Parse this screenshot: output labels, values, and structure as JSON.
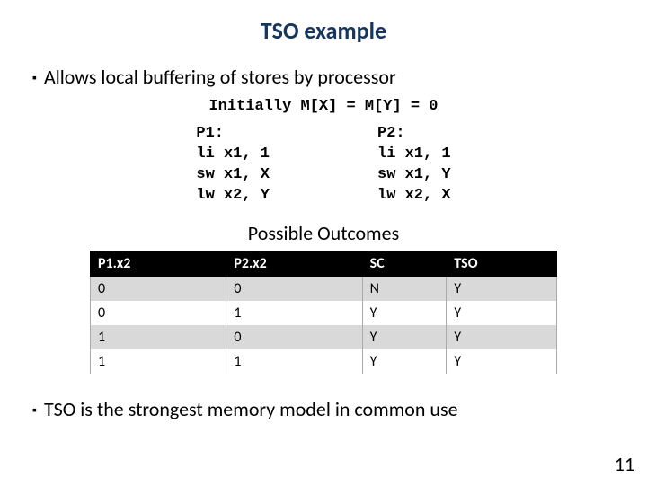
{
  "title": "TSO example",
  "bullet1": "Allows local buffering of stores by processor",
  "initial": "Initially M[X] = M[Y] = 0",
  "p1": {
    "label": "P1:",
    "l1": "li x1, 1",
    "l2": "sw x1, X",
    "l3": "lw x2, Y"
  },
  "p2": {
    "label": "P2:",
    "l1": "li x1, 1",
    "l2": "sw x1, Y",
    "l3": "lw x2, X"
  },
  "outcomes_title": "Possible Outcomes",
  "headers": {
    "c1": "P1.x2",
    "c2": "P2.x2",
    "c3": "SC",
    "c4": "TSO"
  },
  "rows": [
    {
      "c1": "0",
      "c2": "0",
      "c3": "N",
      "c4": "Y"
    },
    {
      "c1": "0",
      "c2": "1",
      "c3": "Y",
      "c4": "Y"
    },
    {
      "c1": "1",
      "c2": "0",
      "c3": "Y",
      "c4": "Y"
    },
    {
      "c1": "1",
      "c2": "1",
      "c3": "Y",
      "c4": "Y"
    }
  ],
  "bullet2": "TSO is the strongest memory model in common use",
  "page_number": "11",
  "chart_data": {
    "type": "table",
    "title": "Possible Outcomes",
    "columns": [
      "P1.x2",
      "P2.x2",
      "SC",
      "TSO"
    ],
    "rows": [
      [
        "0",
        "0",
        "N",
        "Y"
      ],
      [
        "0",
        "1",
        "Y",
        "Y"
      ],
      [
        "1",
        "0",
        "Y",
        "Y"
      ],
      [
        "1",
        "1",
        "Y",
        "Y"
      ]
    ]
  }
}
